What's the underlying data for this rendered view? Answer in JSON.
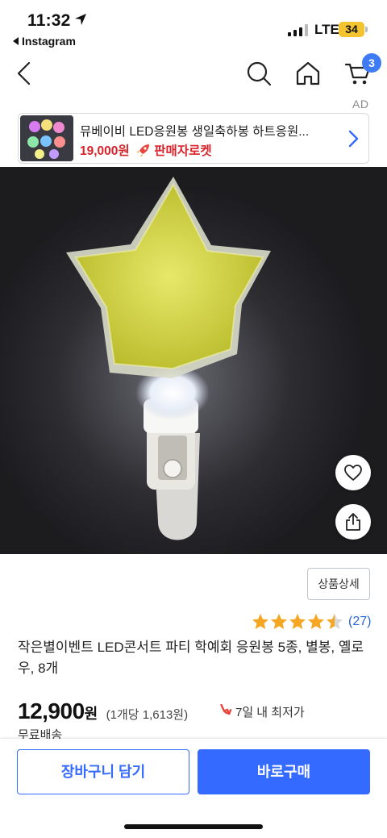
{
  "status_bar": {
    "time": "11:32",
    "back_app": "Instagram",
    "network": "LTE",
    "battery": "34"
  },
  "nav": {
    "cart_count": "3"
  },
  "ad": {
    "label": "AD",
    "title": "뮤베이비 LED응원봉 생일축하봉 하트응원...",
    "price": "19,000원",
    "badge": "판매자로켓"
  },
  "product": {
    "detail_button": "상품상세",
    "rating_value": 4.5,
    "review_count": "(27)",
    "title": "작은별이벤트 LED콘서트 파티 학예회 응원봉 5종, 별봉, 옐로우, 8개",
    "price": "12,900",
    "price_unit": "원",
    "unit_price": "(1개당 1,613원)",
    "lowest_price_note": "7일 내 최저가",
    "shipping": "무료배송"
  },
  "actions": {
    "add_to_cart": "장바구니 담기",
    "buy_now": "바로구매"
  },
  "colors": {
    "accent_blue": "#346aff",
    "price_red": "#d8232a",
    "star_gold": "#f5a623",
    "badge_blue": "#3f7bf5"
  }
}
